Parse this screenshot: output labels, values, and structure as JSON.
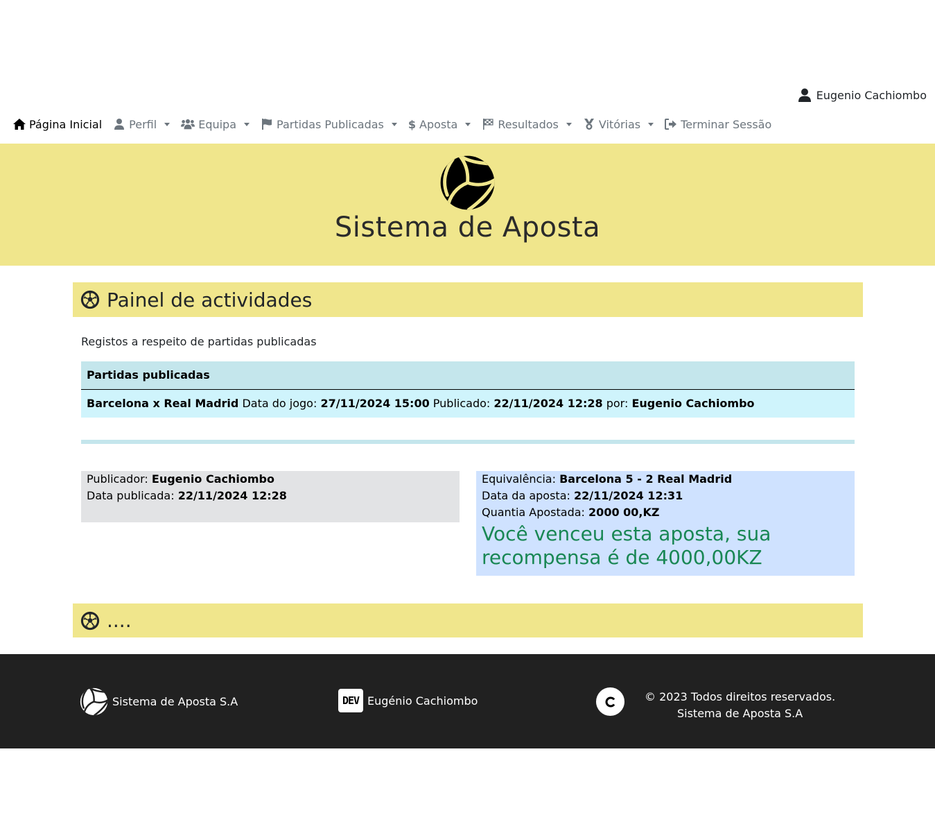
{
  "user": {
    "name": "Eugenio Cachiombo"
  },
  "nav": {
    "items": [
      {
        "label": "Página Inicial",
        "icon": "home-icon"
      },
      {
        "label": "Perfil",
        "icon": "user-icon"
      },
      {
        "label": "Equipa",
        "icon": "users-icon"
      },
      {
        "label": "Partidas Publicadas",
        "icon": "flag-icon"
      },
      {
        "label": "Aposta",
        "icon": "dollar-icon"
      },
      {
        "label": "Resultados",
        "icon": "checkered-flag-icon"
      },
      {
        "label": "Vitórias",
        "icon": "medal-icon"
      },
      {
        "label": "Terminar Sessão",
        "icon": "logout-icon"
      }
    ]
  },
  "hero": {
    "title": "Sistema de Aposta"
  },
  "panel": {
    "title": "Painel de actividades",
    "subtitle": "Registos a respeito de partidas publicadas",
    "table": {
      "header": "Partidas publicadas",
      "row": {
        "match": "Barcelona x Real Madrid",
        "date_label": "Data do jogo:",
        "date": "27/11/2024 15:00",
        "published_label": "Publicado:",
        "published": "22/11/2024 12:28",
        "by_label": "por:",
        "by": "Eugenio Cachiombo"
      }
    }
  },
  "publisher_box": {
    "publisher_label": "Publicador:",
    "publisher": "Eugenio Cachiombo",
    "date_label": "Data publicada:",
    "date": "22/11/2024 12:28"
  },
  "bet_box": {
    "equivalence_label": "Equivalência:",
    "equivalence": "Barcelona 5 - 2 Real Madrid",
    "bet_date_label": "Data da aposta:",
    "bet_date": "22/11/2024 12:31",
    "amount_label": "Quantia Apostada:",
    "amount": "2000 00,KZ",
    "win_message": "Você venceu esta aposta, sua recompensa é de 4000,00KZ"
  },
  "second_panel": {
    "title": "...."
  },
  "footer": {
    "brand": "Sistema de Aposta S.A",
    "dev_badge": "DEV",
    "dev_name": "Eugénio Cachiombo",
    "copyright_line1": "© 2023 Todos direitos reservados.",
    "copyright_line2": "Sistema de Aposta S.A"
  },
  "colors": {
    "accent_yellow": "#f0e68c",
    "table_header": "#c4e6ec",
    "table_row": "#cff4fc",
    "win_green": "#198754",
    "footer_bg": "#212121"
  }
}
